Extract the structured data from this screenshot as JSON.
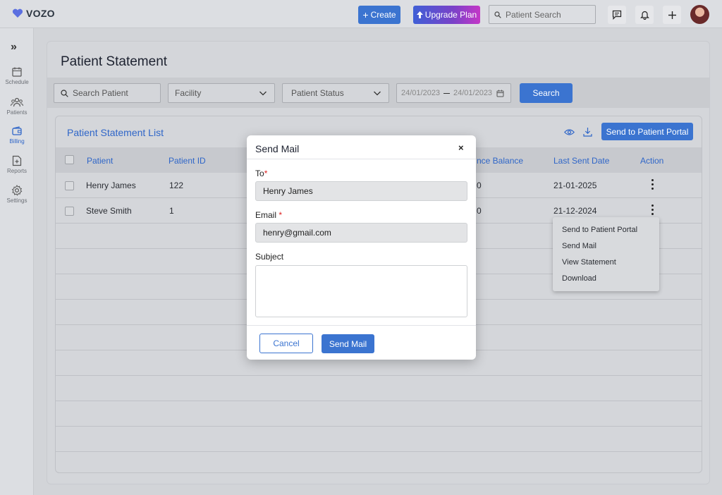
{
  "header": {
    "logo_text": "VOZO",
    "create_label": "Create",
    "upgrade_label": "Upgrade Plan",
    "search_placeholder": "Patient Search"
  },
  "sidebar": {
    "items": [
      {
        "label": "Schedule",
        "icon": "calendar-icon"
      },
      {
        "label": "Patients",
        "icon": "users-icon"
      },
      {
        "label": "Billing",
        "icon": "wallet-icon",
        "active": true
      },
      {
        "label": "Reports",
        "icon": "report-icon"
      },
      {
        "label": "Settings",
        "icon": "gear-icon"
      }
    ]
  },
  "page": {
    "title": "Patient Statement"
  },
  "filters": {
    "search_placeholder": "Search Patient",
    "facility_label": "Facility",
    "status_label": "Patient Status",
    "date_from": "24/01/2023",
    "date_to": "24/01/2023",
    "search_button": "Search"
  },
  "list": {
    "title": "Patient Statement List",
    "send_portal_button": "Send to Patient Portal",
    "columns": [
      "Patient",
      "Patient ID",
      "nce Balance",
      "Last Sent Date",
      "Action"
    ],
    "rows": [
      {
        "patient": "Henry James",
        "patient_id": "122",
        "balance": "0",
        "last_sent": "21-01-2025"
      },
      {
        "patient": "Steve Smith",
        "patient_id": "1",
        "balance": "0",
        "last_sent": "21-12-2024"
      }
    ]
  },
  "context_menu": {
    "items": [
      "Send to Patient Portal",
      "Send Mail",
      "View Statement",
      "Download"
    ]
  },
  "modal": {
    "title": "Send Mail",
    "close": "×",
    "to_label": "To",
    "to_value": "Henry James",
    "email_label": "Email",
    "email_value": "henry@gmail.com",
    "subject_label": "Subject",
    "subject_value": "",
    "required_mark": "*",
    "cancel_label": "Cancel",
    "send_label": "Send Mail"
  },
  "colors": {
    "accent": "#3b74d0",
    "link": "#2f66c8",
    "required": "#dd2222"
  }
}
